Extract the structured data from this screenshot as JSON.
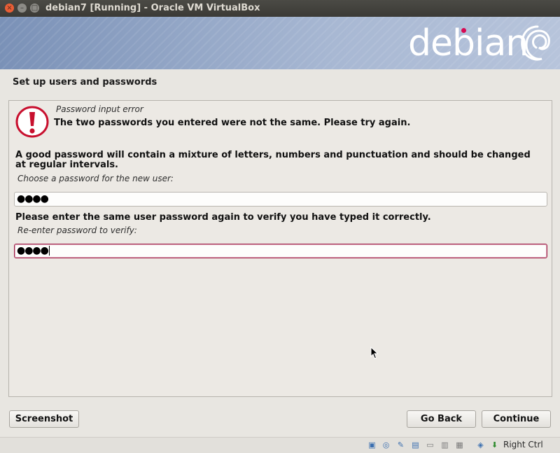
{
  "window": {
    "title": "debian7 [Running] - Oracle VM VirtualBox"
  },
  "banner": {
    "logo_text": "debian"
  },
  "page": {
    "title": "Set up users and passwords"
  },
  "error": {
    "title": "Password input error",
    "message": "The two passwords you entered were not the same. Please try again."
  },
  "form": {
    "description": "A good password will contain a mixture of letters, numbers and punctuation and should be changed at regular intervals.",
    "password_label": "Choose a password for the new user:",
    "password_value": "●●●●",
    "verify_prompt": "Please enter the same user password again to verify you have typed it correctly.",
    "verify_label": "Re-enter password to verify:",
    "verify_value": "●●●●"
  },
  "buttons": {
    "screenshot": "Screenshot",
    "go_back": "Go Back",
    "continue": "Continue"
  },
  "statusbar": {
    "host_key": "Right Ctrl",
    "icons": [
      "hard-disk-icon",
      "optical-drive-icon",
      "usb-icon",
      "network-icon",
      "shared-folders-icon",
      "display-icon",
      "video-capture-icon",
      "cpu-icon",
      "mouse-integration-icon",
      "keyboard-capture-icon"
    ]
  },
  "colors": {
    "accent": "#d70a53",
    "error_red": "#c8102e",
    "focus_border": "#a1214a"
  }
}
